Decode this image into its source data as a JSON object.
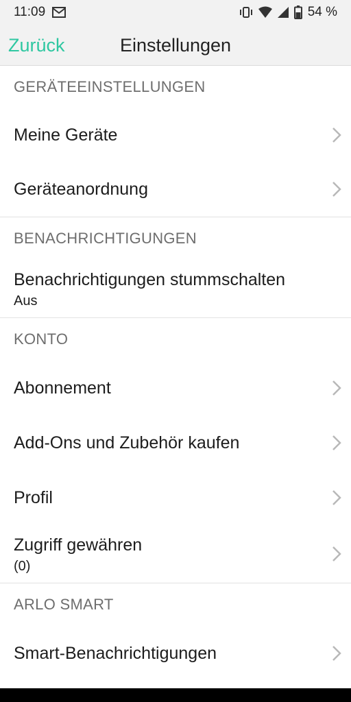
{
  "status_bar": {
    "time": "11:09",
    "battery": "54 %",
    "icons": [
      "gmail-icon",
      "vibrate-icon",
      "wifi-icon",
      "signal-icon",
      "battery-icon"
    ]
  },
  "nav": {
    "back_label": "Zurück",
    "title": "Einstellungen",
    "accent_color": "#2fc7a1"
  },
  "sections": [
    {
      "header": "GERÄTEEINSTELLUNGEN",
      "items": [
        {
          "label": "Meine Geräte",
          "chevron": true
        },
        {
          "label": "Geräteanordnung",
          "chevron": true
        }
      ]
    },
    {
      "header": "BENACHRICHTIGUNGEN",
      "items": [
        {
          "label": "Benachrichtigungen stummschalten",
          "subtitle": "Aus",
          "chevron": false
        }
      ]
    },
    {
      "header": "KONTO",
      "items": [
        {
          "label": "Abonnement",
          "chevron": true
        },
        {
          "label": "Add-Ons und Zubehör kaufen",
          "chevron": true
        },
        {
          "label": "Profil",
          "chevron": true
        },
        {
          "label": "Zugriff gewähren",
          "subtitle": "(0)",
          "chevron": true
        }
      ]
    },
    {
      "header": "ARLO SMART",
      "items": [
        {
          "label": "Smart-Benachrichtigungen",
          "chevron": true
        }
      ]
    }
  ]
}
